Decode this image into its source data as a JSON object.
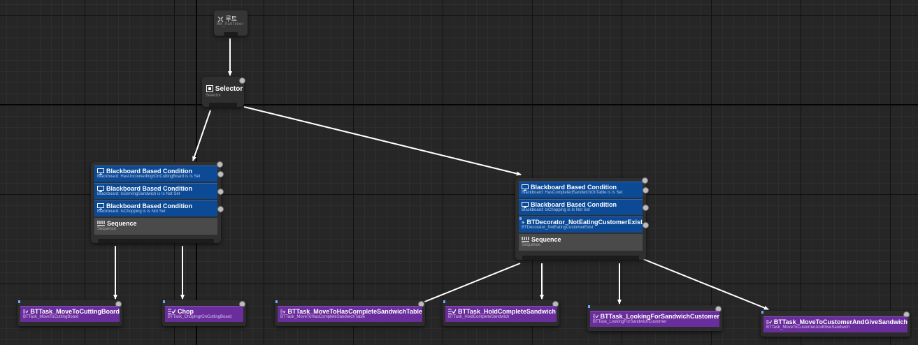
{
  "root": {
    "title": "루트",
    "blackboard": "BB_PartTimer"
  },
  "selector": {
    "title": "Selector",
    "subtitle": "Selector"
  },
  "left_sequence": {
    "decorators": [
      {
        "title": "Blackboard Based Condition",
        "detail": "Blackboard: HasUncookedIngrOnCuttingBoard is Is Set"
      },
      {
        "title": "Blackboard Based Condition",
        "detail": "Blackboard: IsServingSandwich is Is Not Set"
      },
      {
        "title": "Blackboard Based Condition",
        "detail": "Blackboard: IsChopping is Is Not Set"
      }
    ],
    "composite": {
      "title": "Sequence",
      "subtitle": "Sequence"
    }
  },
  "right_sequence": {
    "decorators": [
      {
        "title": "Blackboard Based Condition",
        "detail": "Blackboard: HasCompletedSandwichOnTable is Is Set"
      },
      {
        "title": "Blackboard Based Condition",
        "detail": "Blackboard: IsChopping is Is Not Set"
      },
      {
        "title": "BTDecorator_NotEatingCustomerExist",
        "detail": "BTDecorator_NotEatingCustomerExist"
      }
    ],
    "composite": {
      "title": "Sequence",
      "subtitle": "Sequence"
    }
  },
  "tasks": [
    {
      "title": "BTTask_MoveToCuttingBoard",
      "subtitle": "BTTask_MoveToCuttingBoard"
    },
    {
      "title": "Chop",
      "subtitle": "BTTask_ChopIngrOnCuttingBoard"
    },
    {
      "title": "BTTask_MoveToHasCompleteSandwichTable",
      "subtitle": "BTTask_MoveToHasCompleteSandwichTable"
    },
    {
      "title": "BTTask_HoldCompleteSandwich",
      "subtitle": "BTTask_HoldCompleteSandwich"
    },
    {
      "title": "BTTask_LookingForSandwichCustomer",
      "subtitle": "BTTask_LookingForSandwichCustomer"
    },
    {
      "title": "BTTask_MoveToCustomerAndGiveSandwich",
      "subtitle": "BTTask_MoveToCustomerAndGiveSandwich"
    }
  ],
  "colors": {
    "background": "#262626",
    "decorator": "#0c4a96",
    "task": "#6a2e9c",
    "composite": "#4a4a4a",
    "wire": "#ffffff"
  },
  "icons": {
    "root": "root-node-icon",
    "selector": "selector-icon",
    "decorator": "monitor-icon",
    "custom_decorator": "decorator-play-icon",
    "sequence": "sequence-icon",
    "task": "task-checklist-icon"
  }
}
